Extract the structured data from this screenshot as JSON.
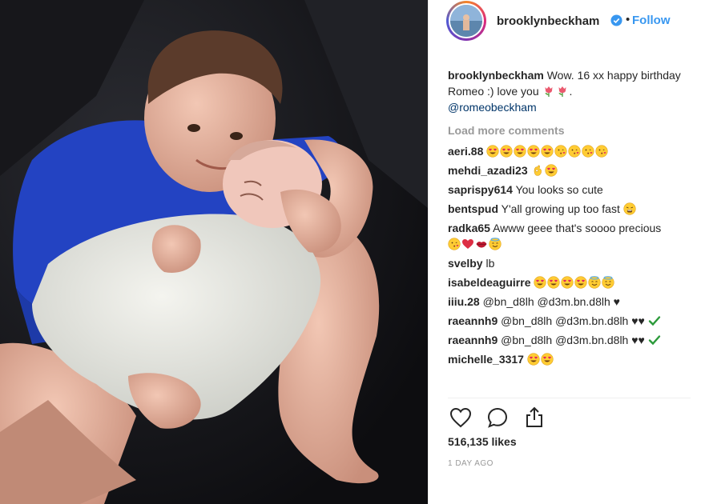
{
  "post": {
    "username": "brooklynbeckham",
    "follow_label": "Follow",
    "dot": "•",
    "caption": {
      "username": "brooklynbeckham",
      "text_1": "Wow. 16 xx happy birthday Romeo :) love you",
      "emoji": [
        "tulip",
        "tulip"
      ],
      "text_2": ".",
      "mention": "@romeobeckham"
    },
    "load_more_label": "Load more comments",
    "comments": [
      {
        "user": "aeri.88",
        "text": "",
        "emoji": [
          "heart-eyes",
          "heart-eyes",
          "heart-eyes",
          "heart-eyes",
          "heart-eyes",
          "kiss",
          "kiss",
          "kiss",
          "kiss"
        ]
      },
      {
        "user": "mehdi_azadi23",
        "text": "",
        "emoji": [
          "ok-hand",
          "heart-eyes"
        ]
      },
      {
        "user": "saprispy614",
        "text": "You looks so cute",
        "emoji": []
      },
      {
        "user": "bentspud",
        "text": "Y'all growing up too fast",
        "emoji": [
          "tired-face"
        ]
      },
      {
        "user": "radka65",
        "text": "Awww geee that's soooo precious",
        "emoji": [
          "kiss",
          "red-heart",
          "lips",
          "smiling-halo"
        ]
      },
      {
        "user": "svelby",
        "text": "lb",
        "emoji": []
      },
      {
        "user": "isabeldeaguirre",
        "text": "",
        "emoji": [
          "heart-eyes",
          "heart-eyes",
          "heart-eyes",
          "heart-eyes",
          "smiling-halo",
          "smiling-halo"
        ]
      },
      {
        "user": "iiiu.28",
        "text": "@bn_d8lh @d3m.bn.d8lh ♥",
        "emoji": []
      },
      {
        "user": "raeannh9",
        "text": "@bn_d8lh @d3m.bn.d8lh ♥♥",
        "emoji": [
          "check"
        ]
      },
      {
        "user": "raeannh9",
        "text": "@bn_d8lh @d3m.bn.d8lh ♥♥",
        "emoji": [
          "check"
        ]
      },
      {
        "user": "michelle_3317",
        "text": "",
        "emoji": [
          "heart-eyes",
          "heart-eyes"
        ]
      }
    ],
    "actions": {
      "like_icon": "heart-outline-icon",
      "comment_icon": "comment-bubble-icon",
      "share_icon": "share-icon"
    },
    "likes": "516,135 likes",
    "timestamp": "1 DAY AGO",
    "colors": {
      "link": "#003569",
      "follow": "#3897f0",
      "verified": "#3897f0",
      "muted": "#999999"
    }
  }
}
